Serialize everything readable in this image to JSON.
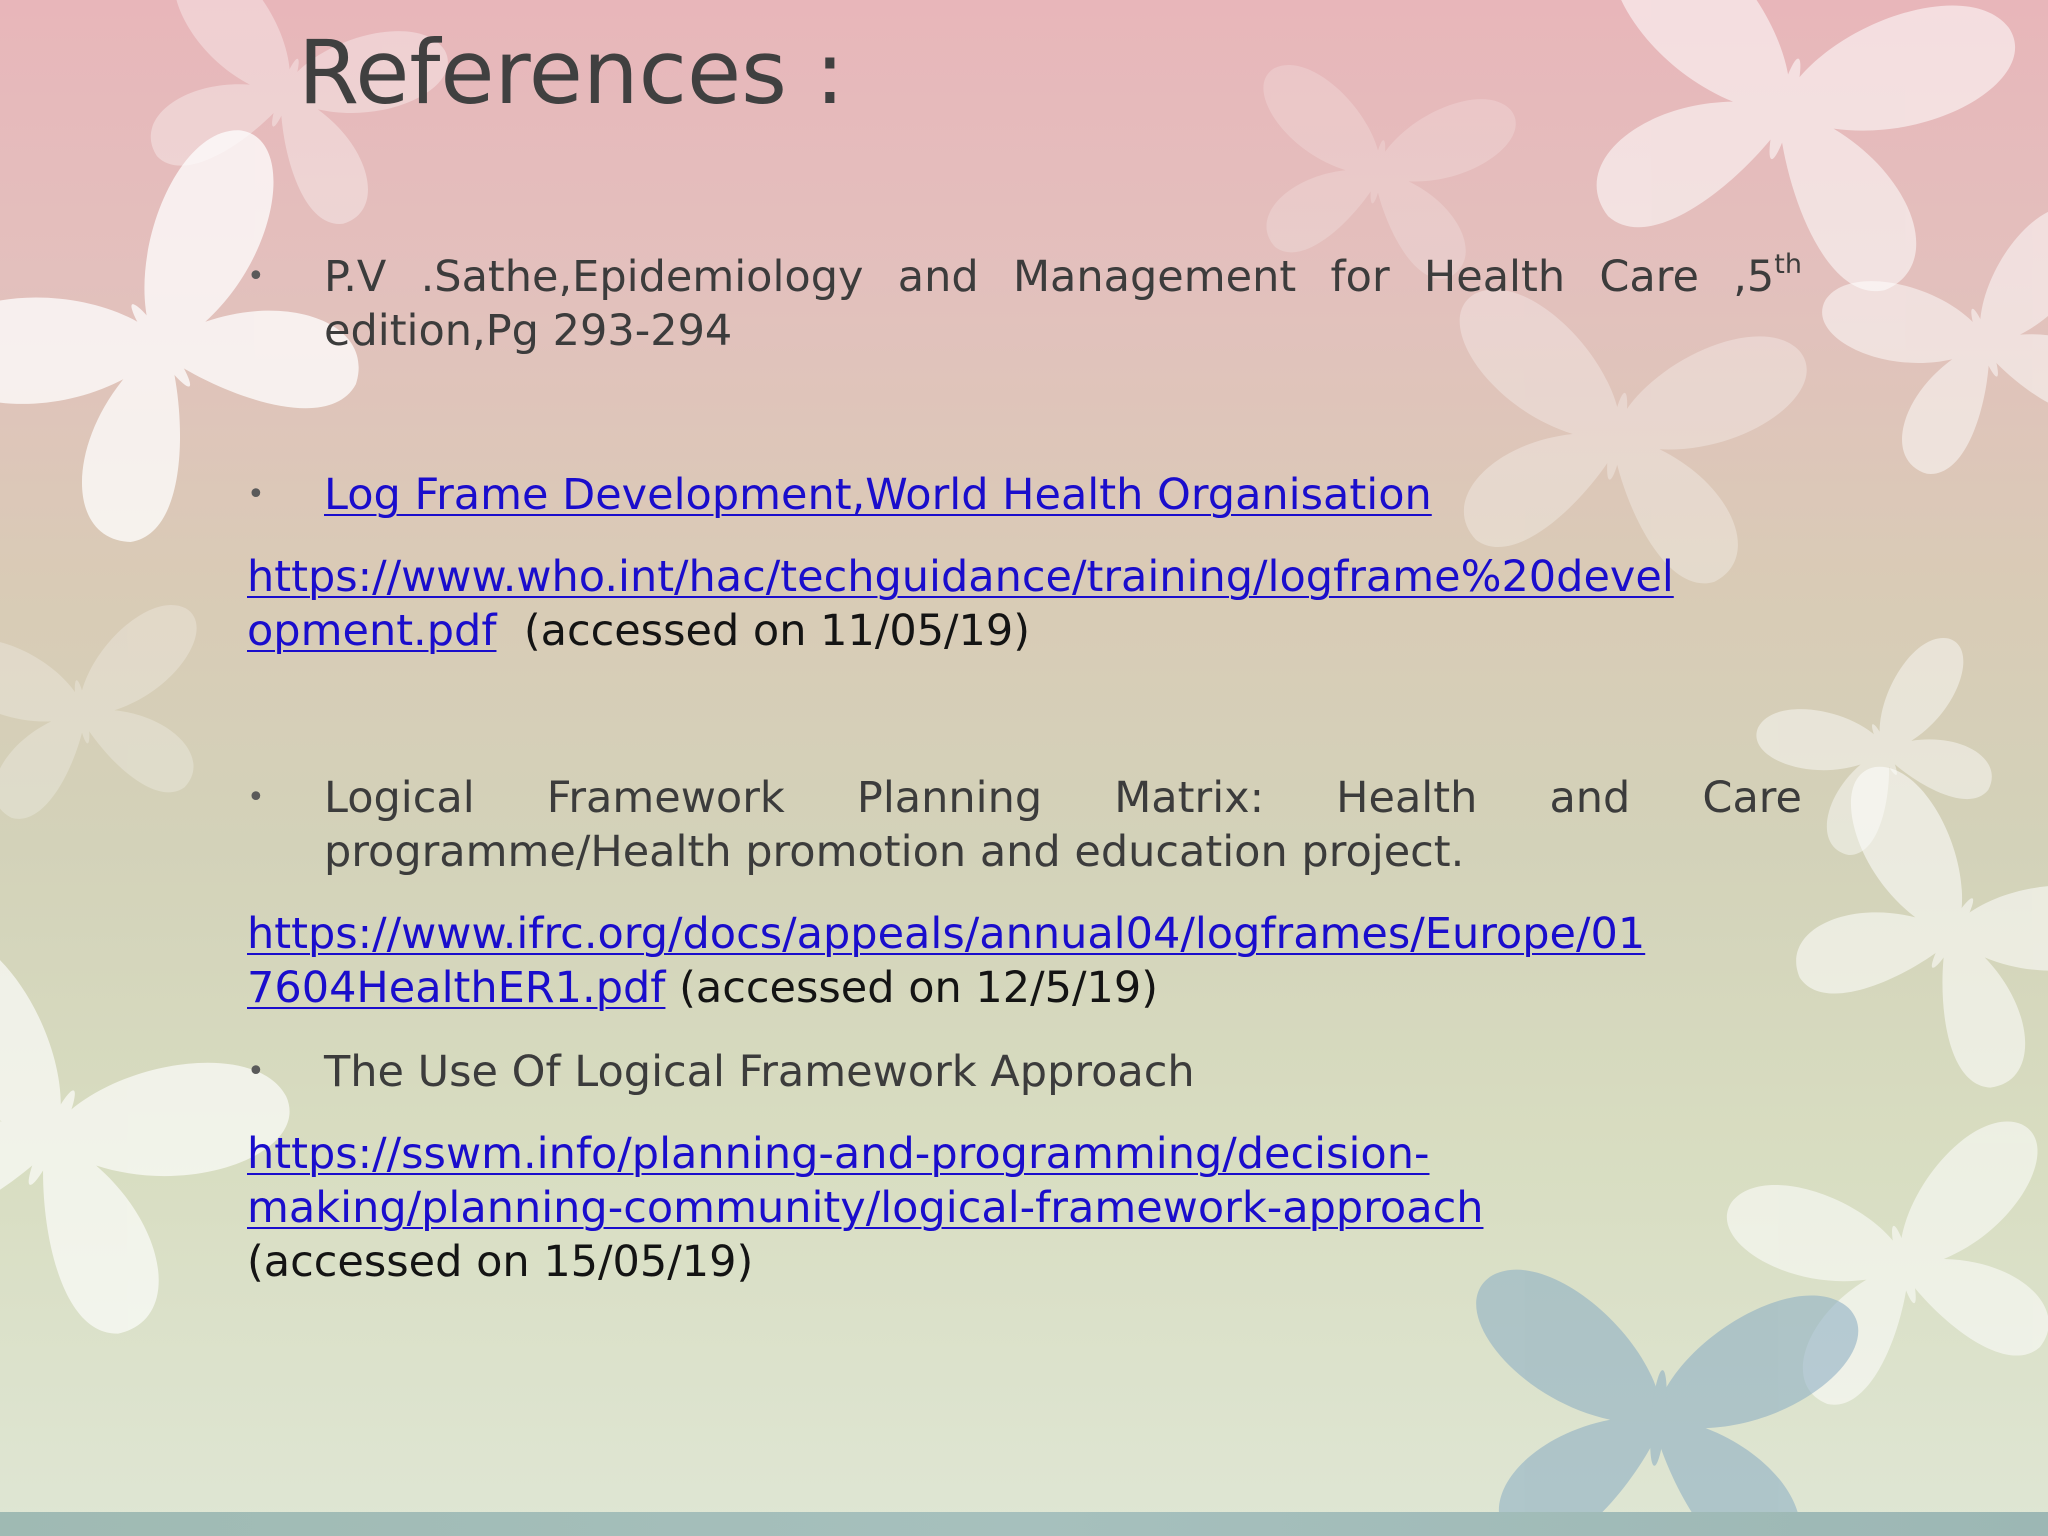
{
  "slide": {
    "title": "References :"
  },
  "references": [
    {
      "text": "P.V .Sathe,Epidemiology and Management for Health Care ,5",
      "sup": "th",
      "text_cont": "edition,Pg 293-294"
    },
    {
      "link_text": "Log Frame Development,World Health Organisation",
      "url_line1": "https://www.who.int/hac/techguidance/training/logframe%20devel",
      "url_line2": "opment.pdf",
      "accessed": "(accessed on 11/05/19)"
    },
    {
      "text_line1": "Logical Framework Planning Matrix: Health and Care",
      "text_line2": "programme/Health promotion and education project.",
      "url_line1": "https://www.ifrc.org/docs/appeals/annual04/logframes/Europe/01",
      "url_line2": "7604HealthER1.pdf",
      "accessed": "(accessed on 12/5/19)"
    },
    {
      "text": "The Use Of Logical Framework Approach",
      "url_line1": "https://sswm.info/planning-and-programming/decision-",
      "url_line2": "making/planning-community/logical-framework-approach",
      "accessed": "(accessed on 15/05/19)"
    }
  ],
  "theme": {
    "bullet": "•",
    "link_color": "#1a0dcc",
    "title_color": "#404040",
    "background_motif": "butterfly"
  }
}
